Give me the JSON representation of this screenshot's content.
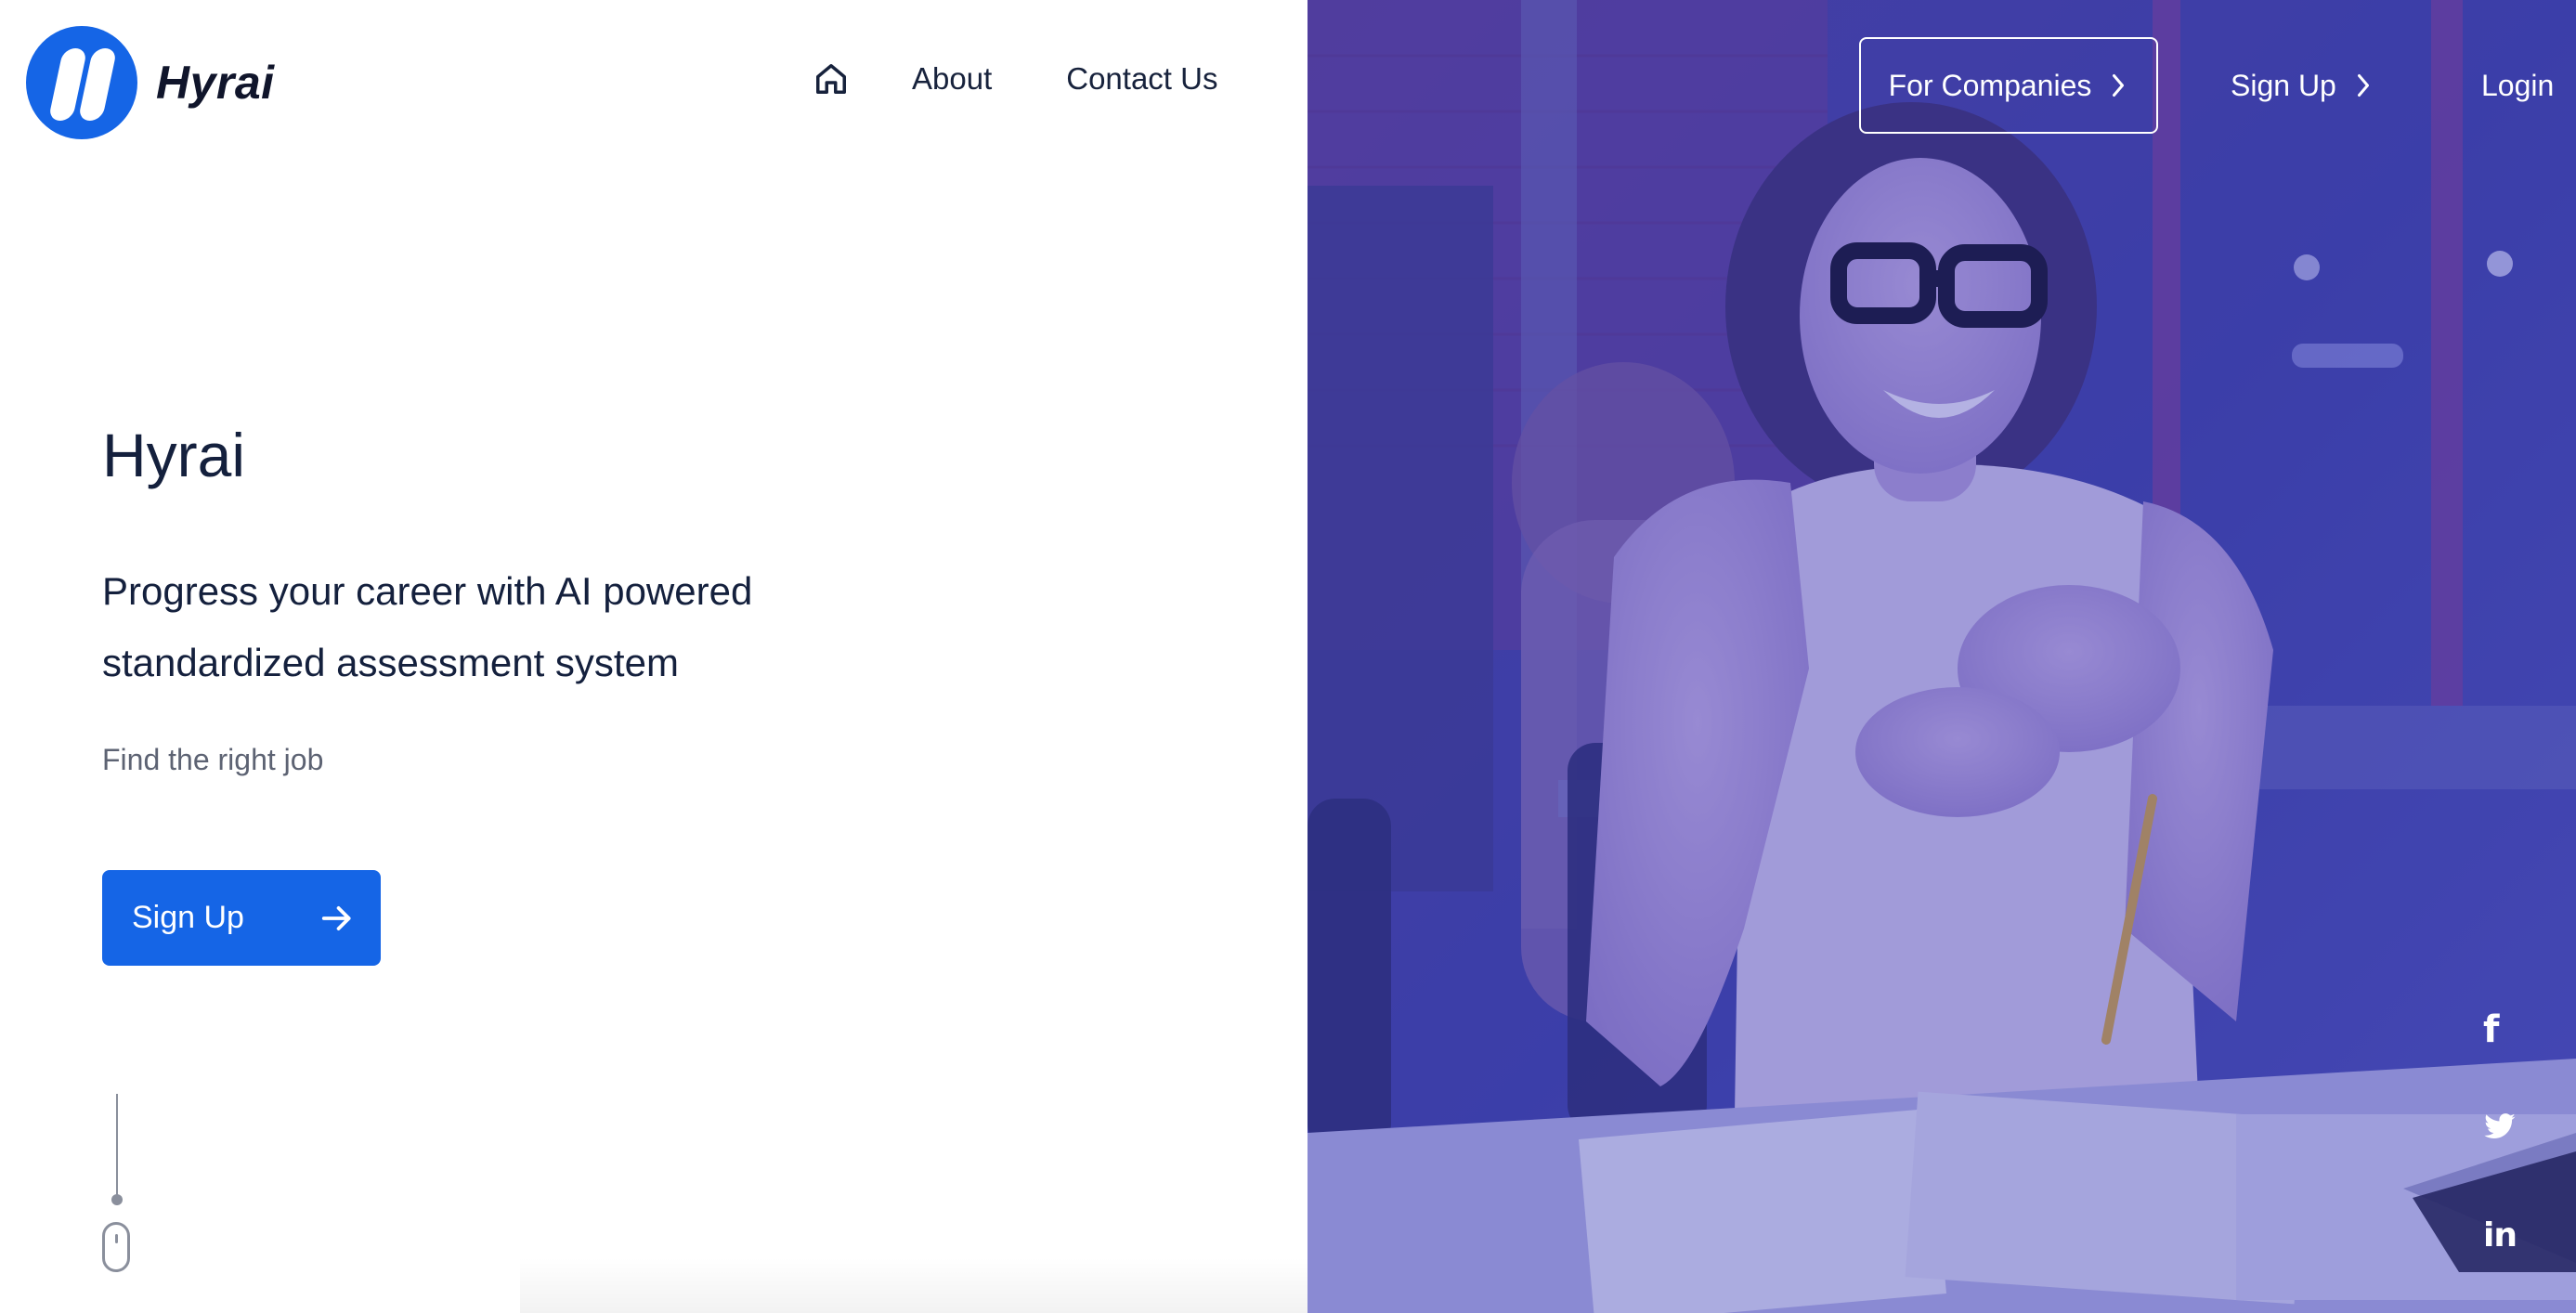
{
  "brand": {
    "name": "Hyrai"
  },
  "nav": {
    "about": "About",
    "contact": "Contact Us"
  },
  "top_right": {
    "for_companies": "For Companies",
    "sign_up": "Sign Up",
    "login": "Login"
  },
  "hero": {
    "title": "Hyrai",
    "subtitle": "Progress your career with AI powered standardized assessment system",
    "tagline": "Find the right job",
    "cta_label": "Sign Up"
  },
  "social": {
    "facebook": "f",
    "linkedin": "in"
  },
  "icons": [
    "home-icon",
    "chevron-right-icon",
    "arrow-right-icon",
    "mouse-icon",
    "facebook-icon",
    "twitter-icon",
    "linkedin-icon"
  ],
  "colors": {
    "accent": "#1565e6",
    "overlay": "#3c3fa8",
    "text_dark": "#14203d",
    "text_muted": "#5d6373"
  }
}
